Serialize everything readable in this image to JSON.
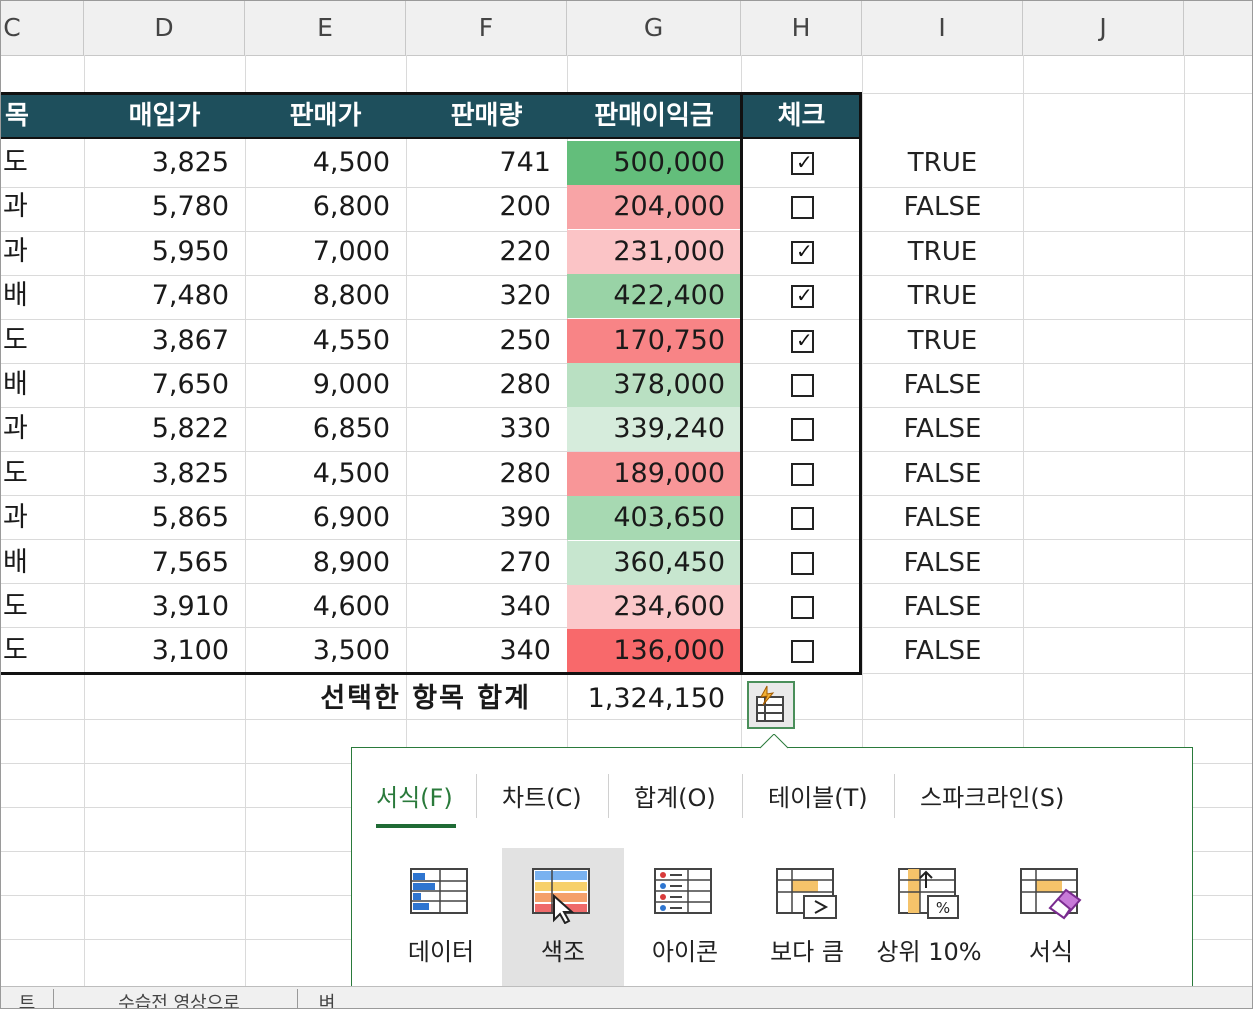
{
  "columns": [
    "C",
    "D",
    "E",
    "F",
    "G",
    "H",
    "I",
    "J"
  ],
  "table_header": {
    "item": "목",
    "purchase": "매입가",
    "price": "판매가",
    "qty": "판매량",
    "profit": "판매이익금",
    "check": "체크"
  },
  "rows": [
    {
      "item": "도",
      "purchase": "3,825",
      "price": "4,500",
      "qty": "741",
      "profit": "500,000",
      "checked": true,
      "bool": "TRUE",
      "color": "#63be7b"
    },
    {
      "item": "과",
      "purchase": "5,780",
      "price": "6,800",
      "qty": "200",
      "profit": "204,000",
      "checked": false,
      "bool": "FALSE",
      "color": "#f8a4a6"
    },
    {
      "item": "과",
      "purchase": "5,950",
      "price": "7,000",
      "qty": "220",
      "profit": "231,000",
      "checked": true,
      "bool": "TRUE",
      "color": "#fbc4c6"
    },
    {
      "item": "배",
      "purchase": "7,480",
      "price": "8,800",
      "qty": "320",
      "profit": "422,400",
      "checked": true,
      "bool": "TRUE",
      "color": "#99d3a6"
    },
    {
      "item": "도",
      "purchase": "3,867",
      "price": "4,550",
      "qty": "250",
      "profit": "170,750",
      "checked": true,
      "bool": "TRUE",
      "color": "#f88486"
    },
    {
      "item": "배",
      "purchase": "7,650",
      "price": "9,000",
      "qty": "280",
      "profit": "378,000",
      "checked": false,
      "bool": "FALSE",
      "color": "#b9e0c2"
    },
    {
      "item": "과",
      "purchase": "5,822",
      "price": "6,850",
      "qty": "330",
      "profit": "339,240",
      "checked": false,
      "bool": "FALSE",
      "color": "#d6ecdc"
    },
    {
      "item": "도",
      "purchase": "3,825",
      "price": "4,500",
      "qty": "280",
      "profit": "189,000",
      "checked": false,
      "bool": "FALSE",
      "color": "#f89698"
    },
    {
      "item": "과",
      "purchase": "5,865",
      "price": "6,900",
      "qty": "390",
      "profit": "403,650",
      "checked": false,
      "bool": "FALSE",
      "color": "#a7d9b2"
    },
    {
      "item": "배",
      "purchase": "7,565",
      "price": "8,900",
      "qty": "270",
      "profit": "360,450",
      "checked": false,
      "bool": "FALSE",
      "color": "#c7e6cf"
    },
    {
      "item": "도",
      "purchase": "3,910",
      "price": "4,600",
      "qty": "340",
      "profit": "234,600",
      "checked": false,
      "bool": "FALSE",
      "color": "#fbc8ca"
    },
    {
      "item": "도",
      "purchase": "3,100",
      "price": "3,500",
      "qty": "340",
      "profit": "136,000",
      "checked": false,
      "bool": "FALSE",
      "color": "#f8696b"
    }
  ],
  "summary": {
    "label": "선택한 항목 합계",
    "value": "1,324,150"
  },
  "quick_analysis": {
    "tabs": [
      "서식(F)",
      "차트(C)",
      "합계(O)",
      "테이블(T)",
      "스파크라인(S)"
    ],
    "active_tab": "서식(F)",
    "tools": [
      {
        "label": "데이터",
        "icon": "data-bar-icon"
      },
      {
        "label": "색조",
        "icon": "color-scale-icon"
      },
      {
        "label": "아이콘",
        "icon": "icon-set-icon"
      },
      {
        "label": "보다 큼",
        "icon": "greater-than-icon"
      },
      {
        "label": "상위 10%",
        "icon": "top-10-icon"
      },
      {
        "label": "서식",
        "icon": "clear-format-icon"
      }
    ]
  },
  "sheet_tabs": [
    "트",
    "수습전 영상으로",
    "벼"
  ]
}
